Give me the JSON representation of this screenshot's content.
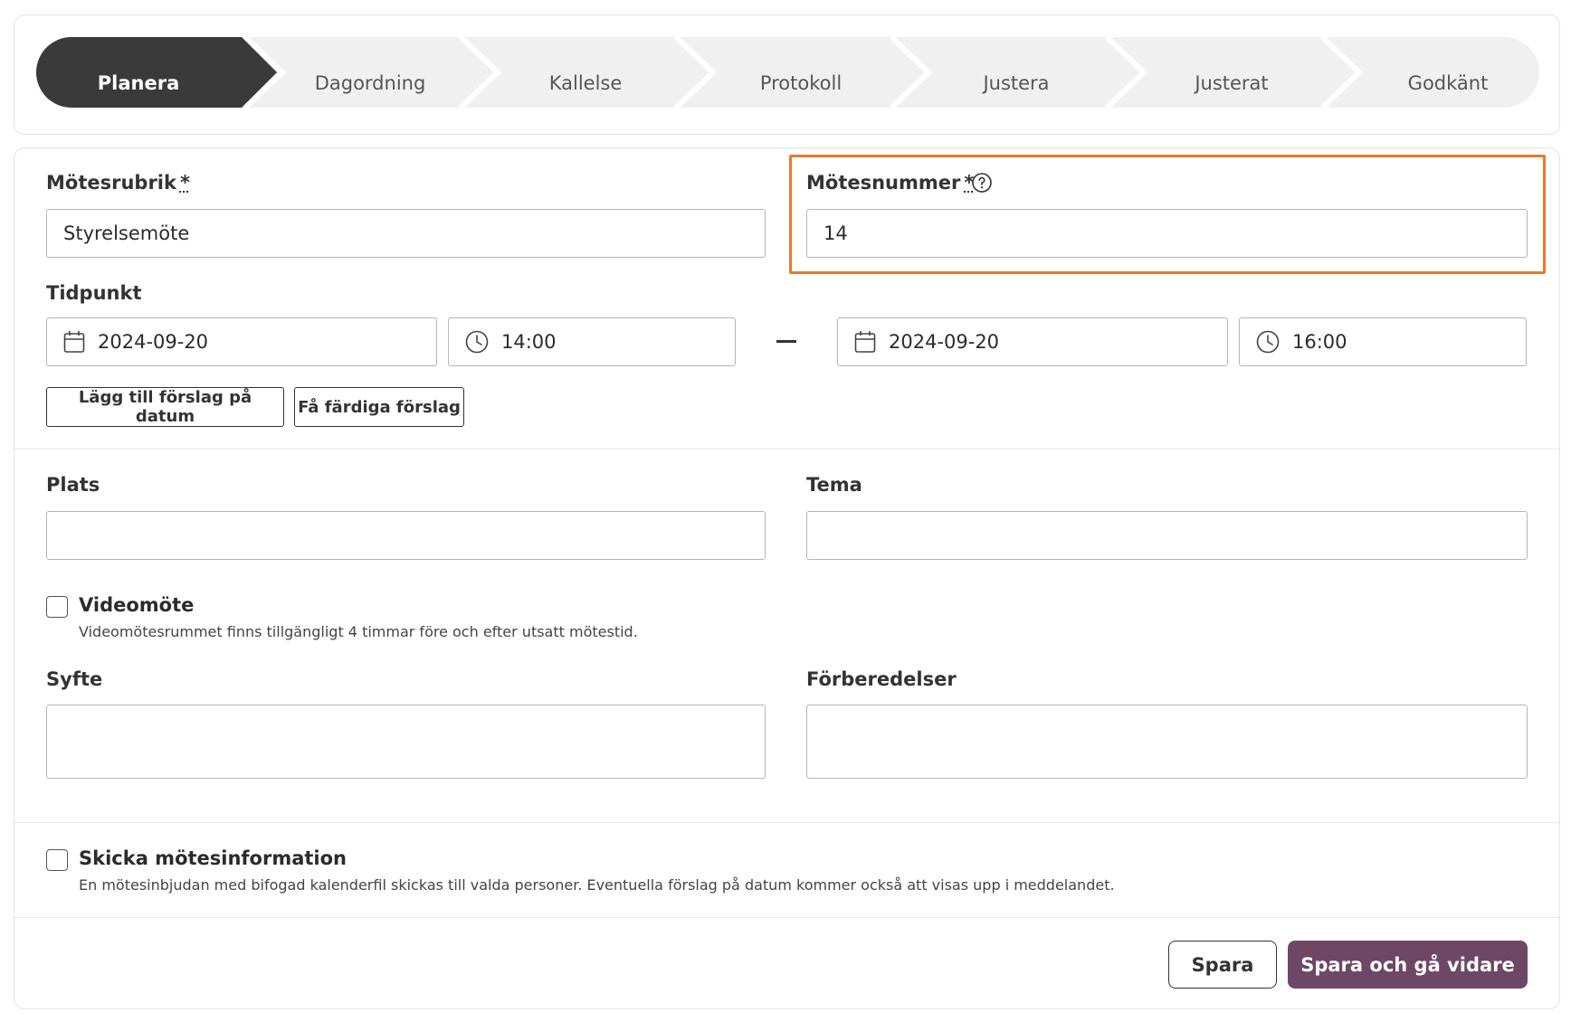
{
  "stepper": {
    "steps": [
      {
        "label": "Planera",
        "active": true
      },
      {
        "label": "Dagordning",
        "active": false
      },
      {
        "label": "Kallelse",
        "active": false
      },
      {
        "label": "Protokoll",
        "active": false
      },
      {
        "label": "Justera",
        "active": false
      },
      {
        "label": "Justerat",
        "active": false
      },
      {
        "label": "Godkänt",
        "active": false
      }
    ]
  },
  "form": {
    "title_label": "Mötesrubrik",
    "title_value": "Styrelsemöte",
    "number_label": "Mötesnummer",
    "number_value": "14",
    "required_marker": "*",
    "time_label": "Tidpunkt",
    "start_date": "2024-09-20",
    "start_time": "14:00",
    "end_date": "2024-09-20",
    "end_time": "16:00",
    "add_suggestion_label": "Lägg till förslag på datum",
    "get_suggestions_label": "Få färdiga förslag",
    "place_label": "Plats",
    "place_value": "",
    "theme_label": "Tema",
    "theme_value": "",
    "video_label": "Videomöte",
    "video_checked": false,
    "video_hint": "Videomötesrummet finns tillgängligt 4 timmar före och efter utsatt mötestid.",
    "purpose_label": "Syfte",
    "purpose_value": "",
    "prep_label": "Förberedelser",
    "prep_value": "",
    "send_info_label": "Skicka mötesinformation",
    "send_info_checked": false,
    "send_info_hint": "En mötesinbjudan med bifogad kalenderfil skickas till valda personer. Eventuella förslag på datum kommer också att visas upp i meddelandet."
  },
  "actions": {
    "save_label": "Spara",
    "save_continue_label": "Spara och gå vidare"
  },
  "colors": {
    "active_step": "#3a3a3a",
    "inactive_step": "#f0f0f0",
    "primary": "#6e4766",
    "highlight": "#e8792f"
  },
  "icons": {
    "date": "calendar-icon",
    "time": "clock-icon",
    "help": "help-icon"
  }
}
